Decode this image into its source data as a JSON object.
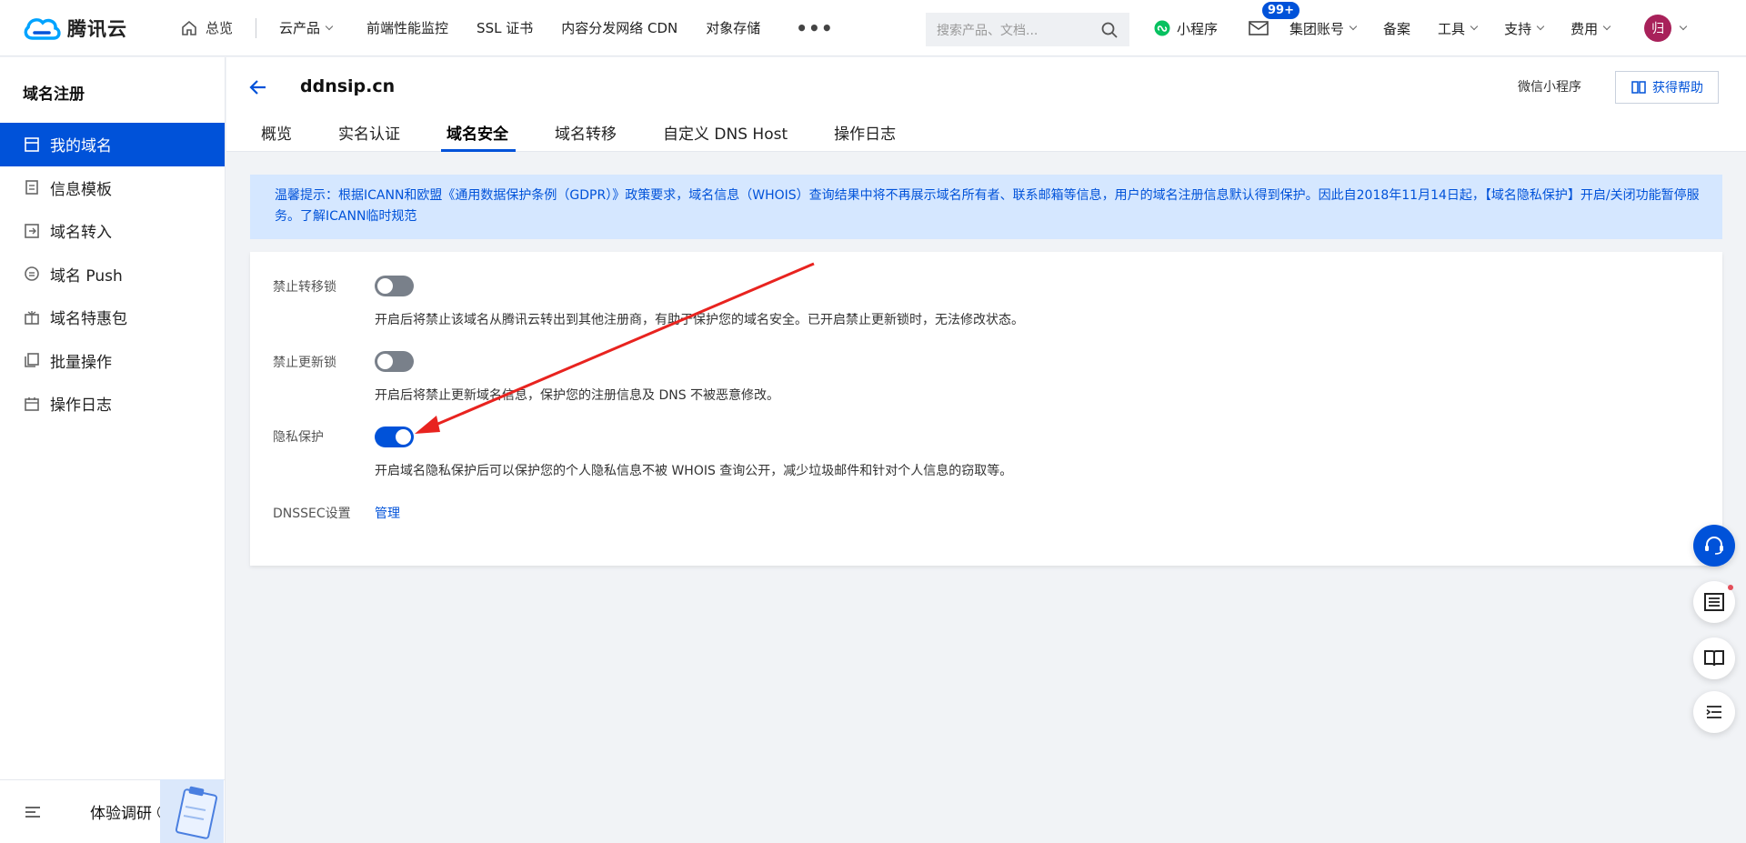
{
  "topnav": {
    "brand": "腾讯云",
    "home": "总览",
    "products": "云产品",
    "links": [
      "前端性能监控",
      "SSL 证书",
      "内容分发网络 CDN",
      "对象存储"
    ],
    "more": "•••",
    "search_placeholder": "搜索产品、文档...",
    "mini_program": "小程序",
    "mail_badge": "99+",
    "group_account": "集团账号",
    "filing": "备案",
    "tools": "工具",
    "support": "支持",
    "billing": "费用",
    "avatar_text": "归"
  },
  "sidebar": {
    "title": "域名注册",
    "items": [
      {
        "label": "我的域名",
        "icon": "domain-icon"
      },
      {
        "label": "信息模板",
        "icon": "template-icon"
      },
      {
        "label": "域名转入",
        "icon": "transfer-in-icon"
      },
      {
        "label": "域名 Push",
        "icon": "push-icon"
      },
      {
        "label": "域名特惠包",
        "icon": "package-icon"
      },
      {
        "label": "批量操作",
        "icon": "batch-icon"
      },
      {
        "label": "操作日志",
        "icon": "calendar-icon"
      }
    ],
    "feedback": "体验调研"
  },
  "header": {
    "domain": "ddnsip.cn",
    "mini_program": "微信小程序",
    "help": "获得帮助",
    "tabs": [
      "概览",
      "实名认证",
      "域名安全",
      "域名转移",
      "自定义 DNS Host",
      "操作日志"
    ],
    "active_tab": "域名安全"
  },
  "notice": {
    "text": "温馨提示：根据ICANN和欧盟《通用数据保护条例（GDPR）》政策要求，域名信息（WHOIS）查询结果中将不再展示域名所有者、联系邮箱等信息，用户的域名注册信息默认得到保护。因此自2018年11月14日起，【域名隐私保护】开启/关闭功能暂停服务。",
    "link": "了解ICANN临时规范"
  },
  "settings": {
    "transfer_lock": {
      "label": "禁止转移锁",
      "enabled": false,
      "desc": "开启后将禁止该域名从腾讯云转出到其他注册商，有助于保护您的域名安全。已开启禁止更新锁时，无法修改状态。"
    },
    "update_lock": {
      "label": "禁止更新锁",
      "enabled": false,
      "desc": "开启后将禁止更新域名信息，保护您的注册信息及 DNS 不被恶意修改。"
    },
    "privacy": {
      "label": "隐私保护",
      "enabled": true,
      "desc": "开启域名隐私保护后可以保护您的个人隐私信息不被 WHOIS 查询公开，减少垃圾邮件和针对个人信息的窃取等。"
    },
    "dnssec": {
      "label": "DNSSEC设置",
      "action": "管理"
    }
  },
  "colors": {
    "primary": "#0052d9",
    "notice_bg": "#d5e7ff",
    "toggle_off": "#79808a",
    "annotation": "#e8231f"
  }
}
